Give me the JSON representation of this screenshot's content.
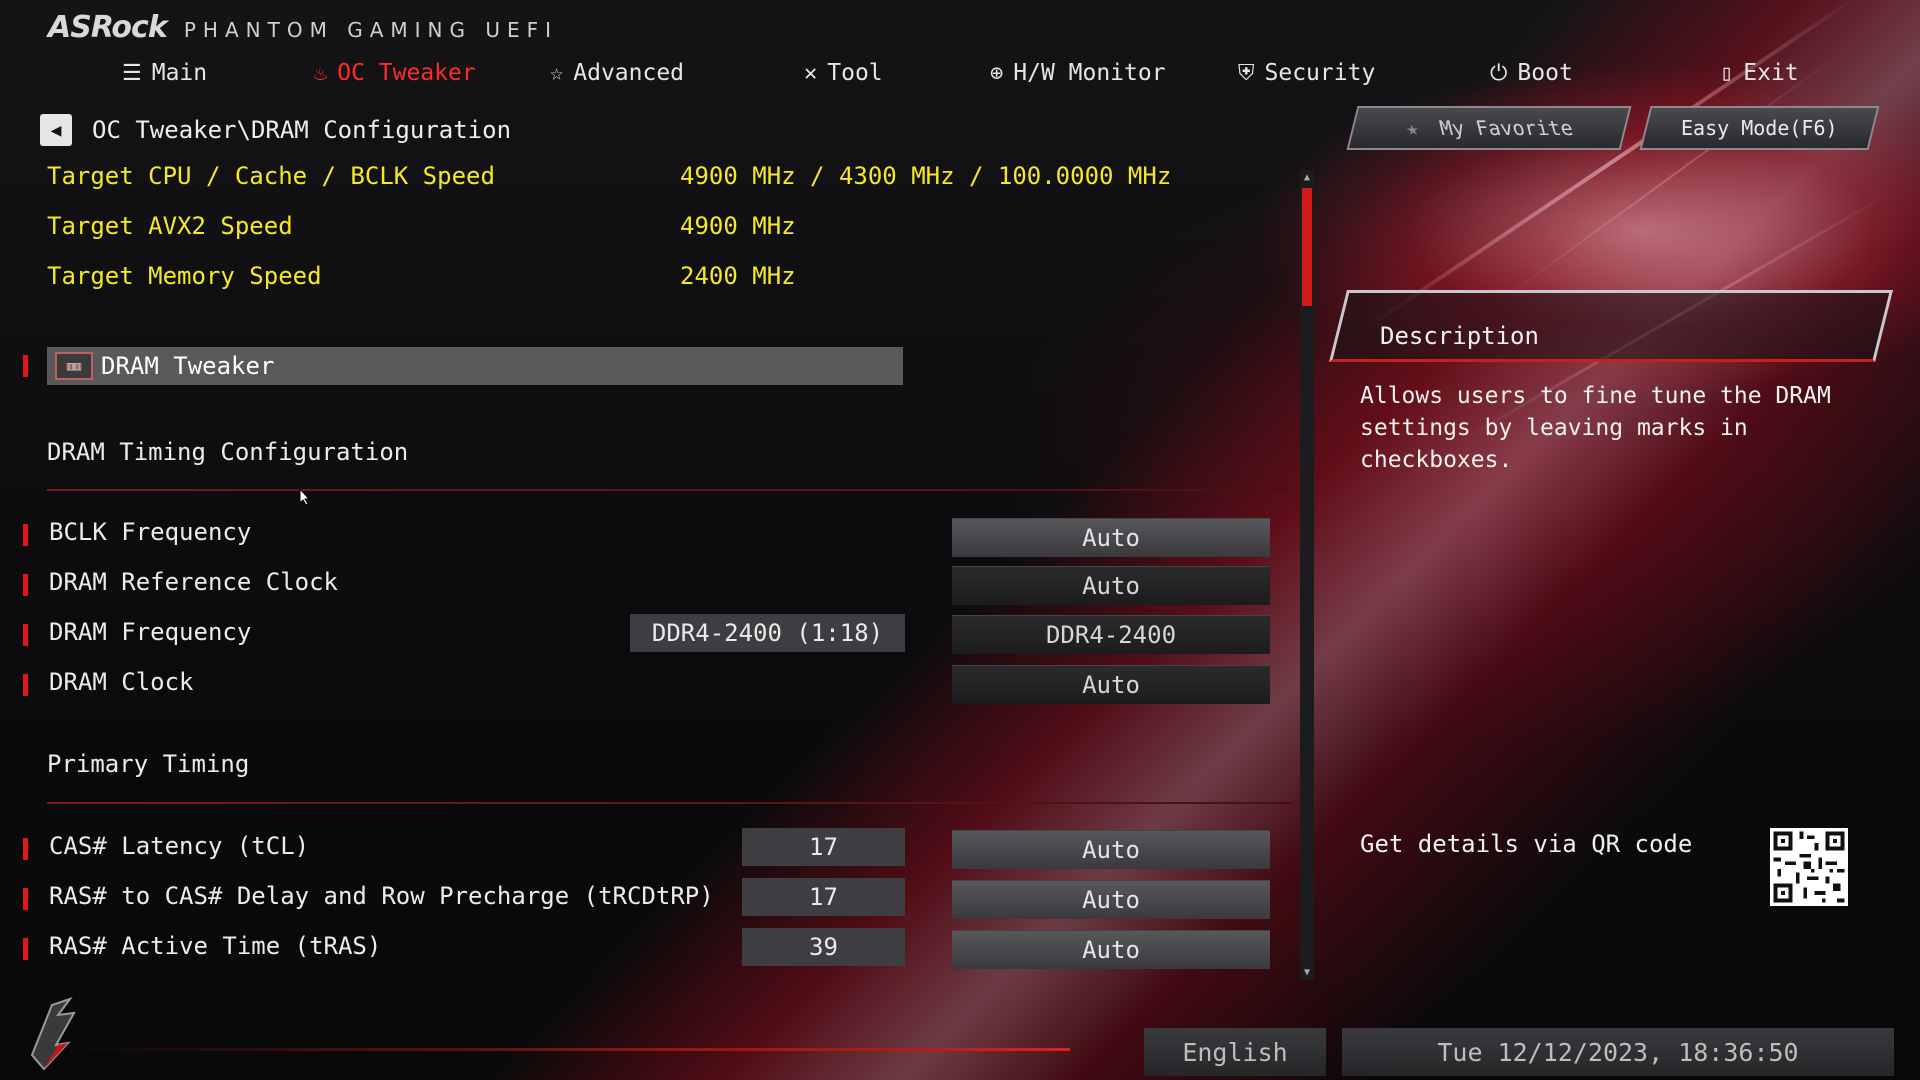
{
  "brand": {
    "logo": "ASRock",
    "subtitle": "PHANTOM GAMING UEFI"
  },
  "nav": [
    {
      "label": "Main",
      "icon": "list-icon",
      "active": false
    },
    {
      "label": "OC Tweaker",
      "icon": "flame-icon",
      "active": true
    },
    {
      "label": "Advanced",
      "icon": "star-icon",
      "active": false
    },
    {
      "label": "Tool",
      "icon": "tools-icon",
      "active": false
    },
    {
      "label": "H/W Monitor",
      "icon": "crosshair-icon",
      "active": false
    },
    {
      "label": "Security",
      "icon": "shield-icon",
      "active": false
    },
    {
      "label": "Boot",
      "icon": "power-icon",
      "active": false
    },
    {
      "label": "Exit",
      "icon": "exit-door-icon",
      "active": false
    }
  ],
  "breadcrumb": {
    "path": "OC Tweaker\\DRAM Configuration"
  },
  "buttons": {
    "favorite": "My Favorite",
    "easy_mode": "Easy Mode(F6)"
  },
  "targets": [
    {
      "label": "Target CPU / Cache / BCLK Speed",
      "value": "4900 MHz / 4300 MHz / 100.0000 MHz"
    },
    {
      "label": "Target AVX2 Speed",
      "value": "4900 MHz"
    },
    {
      "label": "Target Memory Speed",
      "value": "2400 MHz"
    }
  ],
  "section": {
    "label": "DRAM Tweaker"
  },
  "timing_config": {
    "title": "DRAM Timing Configuration",
    "rows": [
      {
        "label": "BCLK Frequency",
        "current": "",
        "setting": "Auto"
      },
      {
        "label": "DRAM Reference Clock",
        "current": "",
        "setting": "Auto"
      },
      {
        "label": "DRAM Frequency",
        "current": "DDR4-2400 (1:18)",
        "setting": "DDR4-2400"
      },
      {
        "label": "DRAM Clock",
        "current": "",
        "setting": "Auto"
      }
    ]
  },
  "primary_timing": {
    "title": "Primary Timing",
    "rows": [
      {
        "label": "CAS# Latency (tCL)",
        "current": "17",
        "setting": "Auto"
      },
      {
        "label": "RAS# to CAS# Delay and Row Precharge (tRCDtRP)",
        "current": "17",
        "setting": "Auto"
      },
      {
        "label": "RAS# Active Time (tRAS)",
        "current": "39",
        "setting": "Auto"
      }
    ]
  },
  "description": {
    "title": "Description",
    "text": "Allows users to fine tune the DRAM\nsettings by leaving marks in\ncheckboxes."
  },
  "qr": {
    "text": "Get details via QR code"
  },
  "footer": {
    "language": "English",
    "datetime": "Tue 12/12/2023, 18:36:50"
  },
  "colors": {
    "accent": "#e01818",
    "highlight_text": "#f5e82a",
    "active_tab": "#ff2b2b"
  }
}
